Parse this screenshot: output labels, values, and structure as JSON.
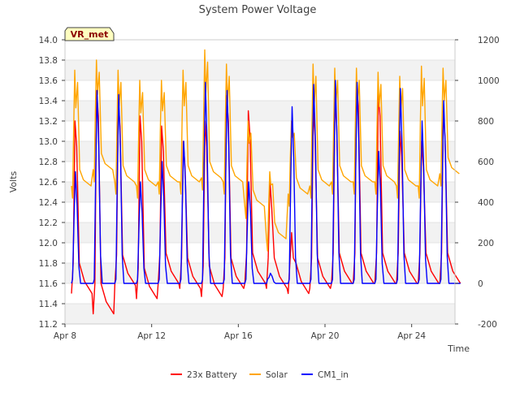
{
  "chart_data": {
    "type": "line",
    "title": "System Power Voltage",
    "xlabel": "Time",
    "ylabel": "Volts",
    "badge": "VR_met",
    "x_ticks": [
      "Apr 8",
      "Apr 12",
      "Apr 16",
      "Apr 20",
      "Apr 24"
    ],
    "x_range_days": [
      8,
      26
    ],
    "y_left": {
      "range": [
        11.2,
        14.0
      ],
      "ticks": [
        "11.2",
        "11.4",
        "11.6",
        "11.8",
        "12.0",
        "12.2",
        "12.4",
        "12.6",
        "12.8",
        "13.0",
        "13.2",
        "13.4",
        "13.6",
        "13.8",
        "14.0"
      ]
    },
    "y_right": {
      "range": [
        -200,
        1200
      ],
      "ticks": [
        "-200",
        "0",
        "200",
        "400",
        "600",
        "800",
        "1000",
        "1200"
      ]
    },
    "grid": true,
    "legend_position": "bottom-center",
    "series": [
      {
        "name": "23x Battery",
        "color": "#ff0000",
        "axis": "left",
        "peaks": [
          13.2,
          13.5,
          13.4,
          13.25,
          13.15,
          13.0,
          13.2,
          13.45,
          13.3,
          12.6,
          12.1,
          13.3,
          13.4,
          13.6,
          13.5,
          13.1,
          13.0,
          13.3
        ],
        "troughs": [
          11.5,
          11.3,
          11.58,
          11.45,
          11.6,
          11.55,
          11.47,
          11.55,
          11.6,
          11.55,
          11.5,
          11.55,
          11.6,
          11.6,
          11.6,
          11.6,
          11.6,
          11.6
        ]
      },
      {
        "name": "Solar",
        "color": "#ffa500",
        "axis": "right",
        "peaks": [
          1050,
          1100,
          1050,
          1000,
          1000,
          1050,
          1150,
          1080,
          800,
          550,
          800,
          1080,
          1060,
          1060,
          1040,
          1020,
          1070,
          1060
        ],
        "troughs": [
          480,
          560,
          500,
          480,
          500,
          500,
          520,
          500,
          380,
          220,
          440,
          480,
          500,
          500,
          500,
          480,
          480,
          540
        ]
      },
      {
        "name": "CM1_in",
        "color": "#0000ff",
        "axis": "right",
        "peaks": [
          550,
          950,
          930,
          500,
          600,
          700,
          990,
          950,
          500,
          50,
          870,
          980,
          1000,
          990,
          650,
          960,
          800,
          900
        ],
        "troughs": [
          0,
          0,
          0,
          0,
          0,
          0,
          0,
          0,
          0,
          0,
          0,
          0,
          0,
          0,
          0,
          0,
          0,
          0
        ]
      }
    ]
  }
}
